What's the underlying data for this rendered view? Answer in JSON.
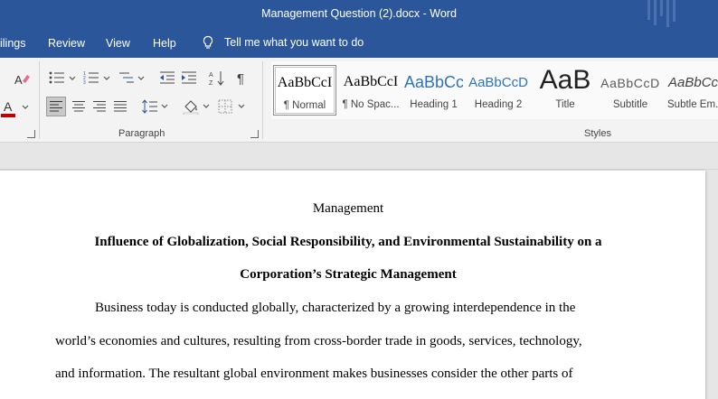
{
  "window": {
    "title": "Management Question (2).docx  -  Word"
  },
  "tabs": {
    "mailings": "ilings",
    "review": "Review",
    "view": "View",
    "help": "Help",
    "tell_me": "Tell me what you want to do"
  },
  "ribbon": {
    "paragraph_group": "Paragraph",
    "styles_group": "Styles",
    "styles": [
      {
        "preview": "AaBbCcI",
        "name": "¶ Normal"
      },
      {
        "preview": "AaBbCcI",
        "name": "¶ No Spac..."
      },
      {
        "preview": "AaBbCc",
        "name": "Heading 1"
      },
      {
        "preview": "AaBbCcD",
        "name": "Heading 2"
      },
      {
        "preview": "AaB",
        "name": "Title"
      },
      {
        "preview": "AaBbCcD",
        "name": "Subtitle"
      },
      {
        "preview": "AaBbCcL",
        "name": "Subtle Em..."
      }
    ],
    "colors": {
      "accent": "#2b579a",
      "font_color": "#c00000",
      "heading_blue": "#2e74b5"
    }
  },
  "document": {
    "header_line": "Management",
    "title_line1": "Influence of Globalization, Social Responsibility, and Environmental Sustainability on a",
    "title_line2": "Corporation’s Strategic Management",
    "body": [
      "Business today is conducted globally, characterized by a growing interdependence in the",
      "world’s economies and cultures, resulting from cross-border trade in goods, services, technology,",
      "and information. The resultant global environment makes businesses consider the other parts of"
    ]
  }
}
